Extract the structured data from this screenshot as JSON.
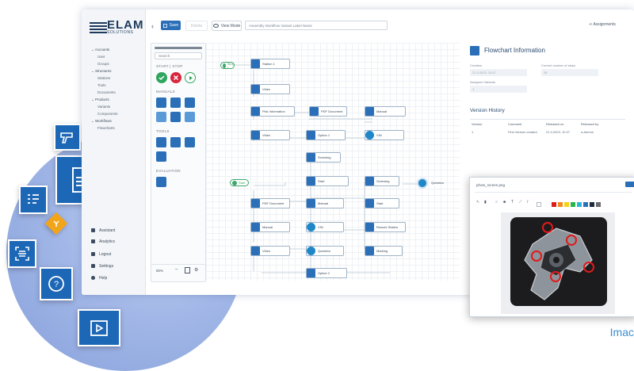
{
  "logo": {
    "text": "ELAM",
    "subtext": "SOLUTIONS"
  },
  "topbar": {
    "back_label": "‹",
    "save_label": "Save",
    "disabled_label": "Delete",
    "view_mode_label": "View Mode",
    "title_placeholder": "Assembly Workflow Variant Label Name",
    "assignments_label": "Assignments"
  },
  "sidebar": {
    "items": [
      {
        "label": "⌄ Accounts",
        "sub": false
      },
      {
        "label": "User",
        "sub": true
      },
      {
        "label": "Groups",
        "sub": true
      },
      {
        "label": "⌄ Structures",
        "sub": false
      },
      {
        "label": "Stations",
        "sub": true
      },
      {
        "label": "Tools",
        "sub": true
      },
      {
        "label": "Documents",
        "sub": true
      },
      {
        "label": "⌄ Products",
        "sub": false
      },
      {
        "label": "Variants",
        "sub": true
      },
      {
        "label": "Components",
        "sub": true
      },
      {
        "label": "⌄ Workflows",
        "sub": false
      },
      {
        "label": "Flowcharts",
        "sub": true
      }
    ],
    "bottom": [
      {
        "label": "Assistant"
      },
      {
        "label": "Analytics"
      },
      {
        "label": "Logout"
      },
      {
        "label": "Settings"
      },
      {
        "label": "Help"
      }
    ]
  },
  "palette": {
    "search_placeholder": "Search",
    "section_start_stop": "START | STOP",
    "section_manual": "MANUALS",
    "section_tools": "TOOLS",
    "section_evaluation": "EVALUATION",
    "zoom": "80%"
  },
  "canvas": {
    "nodes": [
      {
        "label": "Step 1"
      },
      {
        "label": "Station 1"
      },
      {
        "label": "Video"
      },
      {
        "label": "Pick Information"
      },
      {
        "label": "PDF Document"
      },
      {
        "label": "Manual"
      },
      {
        "label": "Video"
      },
      {
        "label": "Option 1"
      },
      {
        "label": "VIN"
      },
      {
        "label": "Screwing"
      },
      {
        "label": "Start"
      },
      {
        "label": "Screwing"
      },
      {
        "label": "Question"
      },
      {
        "label": "Start"
      },
      {
        "label": "PDF Document"
      },
      {
        "label": "Manual"
      },
      {
        "label": "Start"
      },
      {
        "label": "Manual"
      },
      {
        "label": "VIN"
      },
      {
        "label": "Rework Station"
      },
      {
        "label": "Video"
      },
      {
        "label": "Question"
      },
      {
        "label": "Marking"
      },
      {
        "label": "Option 2"
      }
    ]
  },
  "info": {
    "title": "Flowchart Information",
    "created_label": "Creation",
    "created_value": "21.3.2023, 10:17",
    "serial_label": "Current number of steps",
    "serial_value": "28",
    "assigned_label": "Assigned Variants",
    "assigned_value": "1",
    "history_title": "Version History",
    "columns": [
      "Version",
      "Comment",
      "Released on",
      "Released by"
    ],
    "row": [
      "1",
      "First Version created",
      "21.3.2023, 10:27",
      "a.Ammm"
    ]
  },
  "image_window": {
    "filename": "photo_screen.png",
    "swatches": [
      "#e01a1a",
      "#f28a1b",
      "#f5d21a",
      "#29b34a",
      "#27b8d8",
      "#2a6fb8",
      "#1d2a3a",
      "#6a6a6a"
    ]
  },
  "caption": "Imac",
  "colors": {
    "accent": "#2a6fb8",
    "nav": "#1d3a5c",
    "marker": "#e01a1a"
  }
}
